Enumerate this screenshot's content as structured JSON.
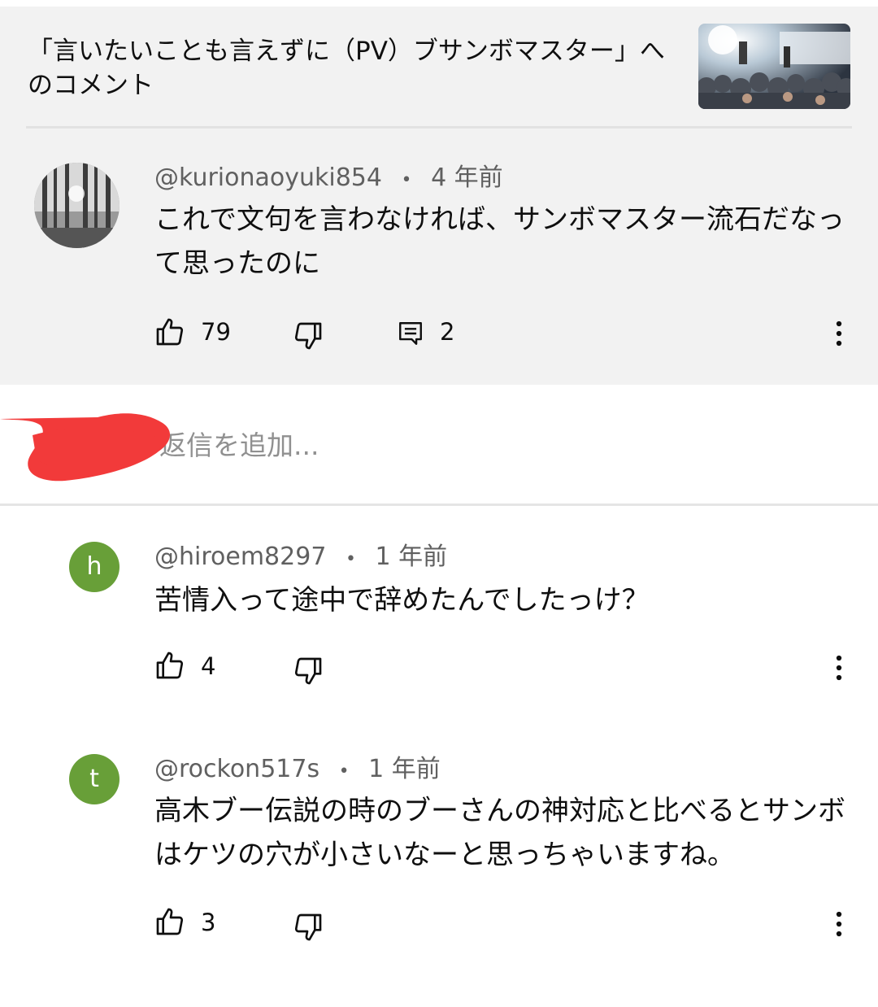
{
  "header": {
    "title": "「言いたいことも言えずに（PV）ブサンボマスター」へのコメント"
  },
  "top_comment": {
    "author": "@kurionaoyuki854",
    "separator": "•",
    "age": "4 年前",
    "text": "これで文句を言わなければ、サンボマスター流石だなって思ったのに",
    "likes": "79",
    "replies": "2"
  },
  "reply_box": {
    "placeholder": "返信を追加..."
  },
  "replies": [
    {
      "avatar_letter": "h",
      "author": "@hiroem8297",
      "separator": "•",
      "age": "1 年前",
      "text": "苦情入って途中で辞めたんでしたっけ？",
      "likes": "4"
    },
    {
      "avatar_letter": "t",
      "author": "@rockon517s",
      "separator": "•",
      "age": "1 年前",
      "text": "高木ブー伝説の時のブーさんの神対応と比べるとサンボはケツの穴が小さいなーと思っちゃいますね。",
      "likes": "3"
    }
  ],
  "colors": {
    "avatar_green": "#689f38",
    "panel_gray": "#f2f2f2",
    "redaction_red": "#f23a3a"
  },
  "icons": [
    "thumbs-up-icon",
    "thumbs-down-icon",
    "reply-icon",
    "more-vert-icon"
  ]
}
